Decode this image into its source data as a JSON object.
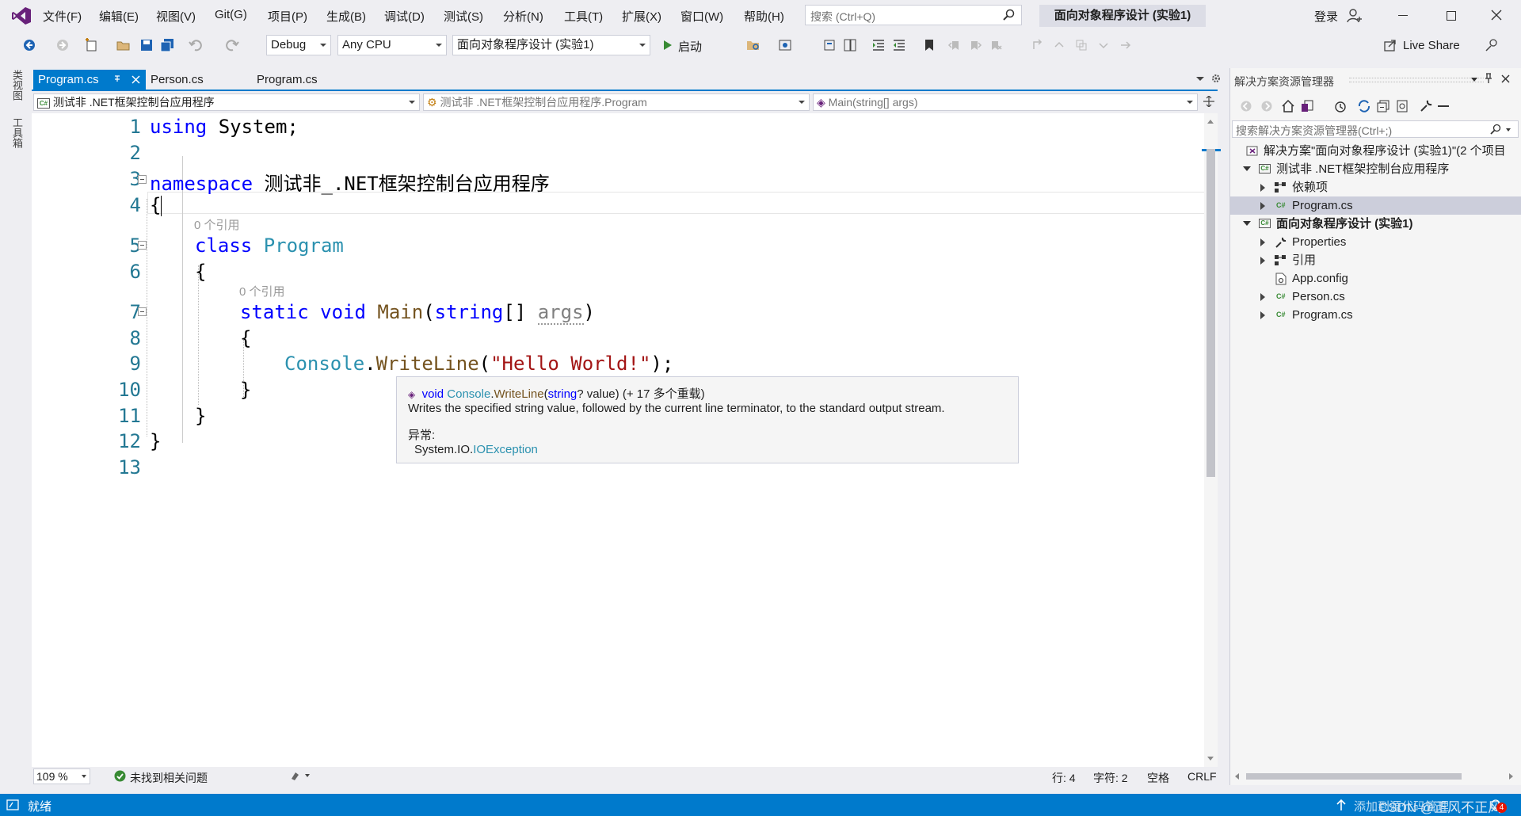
{
  "menu": {
    "items": [
      "文件(F)",
      "编辑(E)",
      "视图(V)",
      "Git(G)",
      "项目(P)",
      "生成(B)",
      "调试(D)",
      "测试(S)",
      "分析(N)",
      "工具(T)",
      "扩展(X)",
      "窗口(W)",
      "帮助(H)"
    ],
    "search_placeholder": "搜索 (Ctrl+Q)",
    "solution_title": "面向对象程序设计 (实验1)",
    "login": "登录"
  },
  "toolbar": {
    "config": "Debug",
    "platform": "Any CPU",
    "startup_project": "面向对象程序设计 (实验1)",
    "start_label": "启动",
    "live_share": "Live Share"
  },
  "left_strip": {
    "tab1": "类视图",
    "tab2": "工具箱"
  },
  "doc_tabs": [
    "Program.cs",
    "Person.cs",
    "Program.cs"
  ],
  "navbar": {
    "project": "测试非 .NET框架控制台应用程序",
    "class": "测试非 .NET框架控制台应用程序.Program",
    "member": "Main(string[] args)"
  },
  "editor": {
    "line_numbers": [
      "1",
      "2",
      "3",
      "4",
      "5",
      "6",
      "7",
      "8",
      "9",
      "10",
      "11",
      "12",
      "13"
    ],
    "lens_class": "0 个引用",
    "lens_method": "0 个引用",
    "code": {
      "l1_kw": "using",
      "l1_rest": " System;",
      "l3_kw": "namespace",
      "l3_rest": " 测试非_.NET框架控制台应用程序",
      "l4": "{",
      "l5_kw": "class",
      "l5_type": "Program",
      "l6": "{",
      "l7_static": "static",
      "l7_void": "void",
      "l7_name": "Main",
      "l7_open": "(",
      "l7_string": "string",
      "l7_br": "[] ",
      "l7_args": "args",
      "l7_close": ")",
      "l8": "{",
      "l9_type": "Console",
      "l9_dot": ".",
      "l9_method": "WriteLine",
      "l9_open": "(",
      "l9_str": "\"Hello World!\"",
      "l9_close": ");",
      "l10": "}",
      "l11": "}",
      "l12": "}"
    }
  },
  "tooltip": {
    "void": "void",
    "class": "Console",
    "dot": ".",
    "method": "WriteLine",
    "open": "(",
    "ptype": "string",
    "pname": "? value)",
    "overloads": " (+ 17 多个重载)",
    "summary": "Writes the specified string value, followed by the current line terminator, to the standard output stream.",
    "exceptions_label": "异常:",
    "exception_ns": "System.IO.",
    "exception_type": "IOException"
  },
  "ed_status": {
    "zoom": "109 %",
    "issues": "未找到相关问题",
    "line": "行: 4",
    "col": "字符: 2",
    "spaces": "空格",
    "eol": "CRLF"
  },
  "solution_explorer": {
    "title": "解决方案资源管理器",
    "search_placeholder": "搜索解决方案资源管理器(Ctrl+;)",
    "rows": [
      "解决方案\"面向对象程序设计 (实验1)\"(2 个项目",
      "测试非 .NET框架控制台应用程序",
      "依赖项",
      "Program.cs",
      "面向对象程序设计 (实验1)",
      "Properties",
      "引用",
      "App.config",
      "Person.cs",
      "Program.cs"
    ]
  },
  "statusbar": {
    "ready": "就绪",
    "source_control": "添加到源代码管理",
    "notification_count": "4",
    "watermark": "CSDN @正风不正风"
  },
  "colors": {
    "accent": "#007acc",
    "keyword": "#0000ff",
    "type": "#2b91af",
    "string": "#a31515",
    "line_number": "#237893"
  }
}
